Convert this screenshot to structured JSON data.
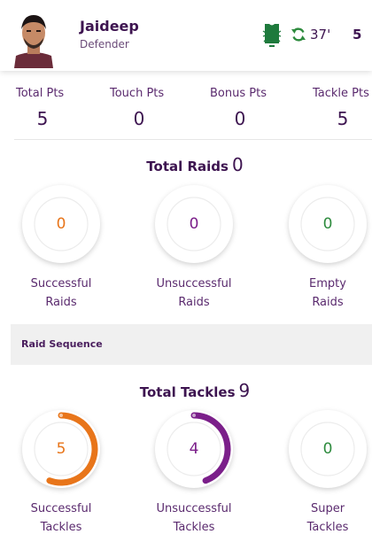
{
  "player": {
    "name": "Jaideep",
    "position": "Defender",
    "minute": "37'",
    "jersey_number": "5",
    "icons": {
      "jersey": "jersey-icon",
      "substitution": "substitution-icon"
    },
    "colors": {
      "jersey": "#1e7a3c",
      "substitution": "#2e8b3e"
    }
  },
  "points": [
    {
      "label": "Total Pts",
      "value": "5"
    },
    {
      "label": "Touch Pts",
      "value": "0"
    },
    {
      "label": "Bonus Pts",
      "value": "0"
    },
    {
      "label": "Tackle Pts",
      "value": "5"
    }
  ],
  "raids": {
    "title": "Total Raids",
    "total": "0",
    "items": [
      {
        "line1": "Successful",
        "line2": "Raids",
        "value": "0",
        "fraction": 0,
        "color": "#e8751a"
      },
      {
        "line1": "Unsuccessful",
        "line2": "Raids",
        "value": "0",
        "fraction": 0,
        "color": "#7b1f8a"
      },
      {
        "line1": "Empty",
        "line2": "Raids",
        "value": "0",
        "fraction": 0,
        "color": "#2e8b3e"
      }
    ]
  },
  "raid_sequence": {
    "label": "Raid Sequence"
  },
  "tackles": {
    "title": "Total Tackles",
    "total": "9",
    "items": [
      {
        "line1": "Successful",
        "line2": "Tackles",
        "value": "5",
        "fraction": 0.556,
        "color": "#e8751a"
      },
      {
        "line1": "Unsuccessful",
        "line2": "Tackles",
        "value": "4",
        "fraction": 0.444,
        "color": "#7b1f8a"
      },
      {
        "line1": "Super",
        "line2": "Tackles",
        "value": "0",
        "fraction": 0,
        "color": "#2e8b3e"
      }
    ]
  }
}
